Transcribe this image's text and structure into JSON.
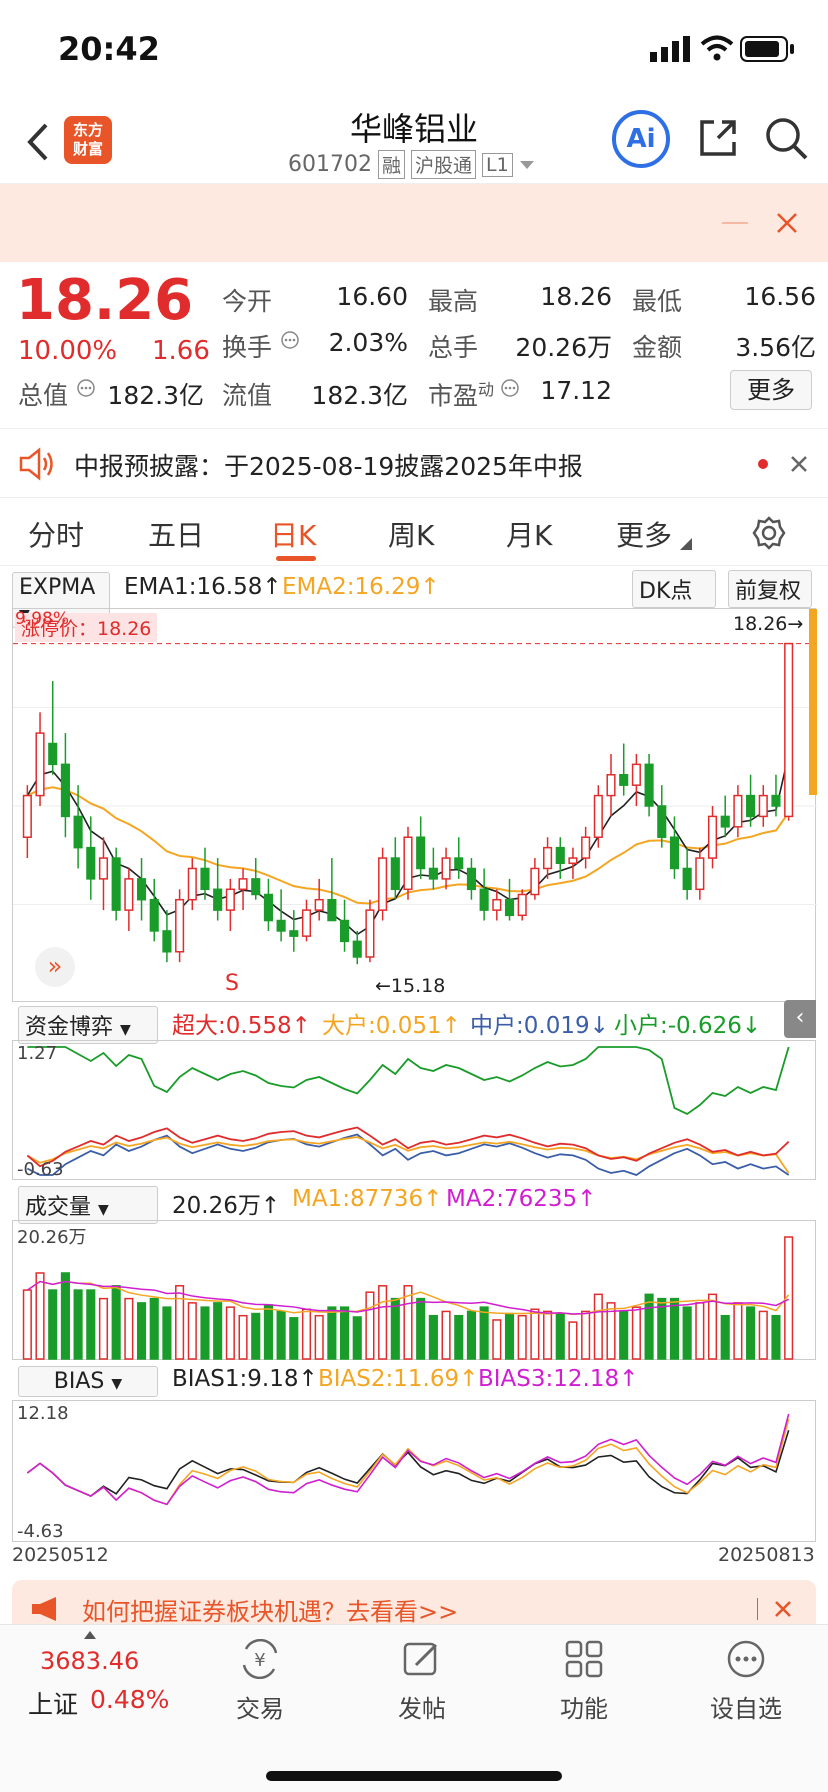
{
  "status_bar": {
    "time": "20:42"
  },
  "nav": {
    "back_icon": "back-icon",
    "logo_text_1": "东方",
    "logo_text_2": "财富",
    "title": "华峰铝业",
    "code": "601702",
    "tags": [
      "融",
      "沪股通",
      "L1"
    ],
    "ai_label": "Ai"
  },
  "quote": {
    "price": "18.26",
    "pct": "10.00%",
    "change": "1.66",
    "rows": [
      [
        {
          "l": "今开",
          "v": "16.60",
          "c": "#222"
        },
        {
          "l": "最高",
          "v": "18.26",
          "c": "#e02c2c"
        },
        {
          "l": "最低",
          "v": "16.56",
          "c": "#1a9c2a"
        }
      ],
      [
        {
          "l": "换手",
          "v": "2.03%",
          "c": "#222"
        },
        {
          "l": "总手",
          "v": "20.26万",
          "c": "#222"
        },
        {
          "l": "金额",
          "v": "3.56亿",
          "c": "#222"
        }
      ],
      [
        {
          "l": "总值",
          "v": "182.3亿",
          "c": "#222"
        },
        {
          "l": "流值",
          "v": "182.3亿",
          "c": "#222"
        },
        {
          "l": "市盈",
          "sup": "动",
          "v": "17.12",
          "c": "#222"
        }
      ]
    ],
    "more": "更多"
  },
  "notice": {
    "text": "中报预披露：于2025-08-19披露2025年中报"
  },
  "tabs": [
    "分时",
    "五日",
    "日K",
    "周K",
    "月K",
    "更多"
  ],
  "active_tab": "日K",
  "main_chart": {
    "indicator": "EXPMA",
    "ema1": "EMA1:16.58",
    "ema2": "EMA2:16.29",
    "dk": "DK点",
    "adjust": "前复权",
    "limit_label": "涨停价：18.26",
    "limit_pct": "9.98%",
    "last_price_tag": "18.26",
    "low_tag": "15.18",
    "s_label": "S"
  },
  "fund_panel": {
    "indicator": "资金博弈",
    "super": "超大:0.558",
    "large": "大户:0.051",
    "mid": "中户:0.019",
    "small": "小户:-0.626",
    "ymax": "1.27",
    "ymin": "-0.63"
  },
  "vol_panel": {
    "indicator": "成交量",
    "vol": "20.26万",
    "ma1": "MA1:87736",
    "ma2": "MA2:76235",
    "ymax": "20.26万"
  },
  "bias_panel": {
    "indicator": "BIAS",
    "b1": "BIAS1:9.18",
    "b2": "BIAS2:11.69",
    "b3": "BIAS3:12.18",
    "ymax": "12.18",
    "ymin": "-4.63"
  },
  "dates": {
    "start": "20250512",
    "end": "20250813"
  },
  "ad": {
    "text": "如何把握证券板块机遇？去看看>>"
  },
  "bottom": {
    "index_value": "3683.46",
    "index_name": "上证",
    "index_pct": "0.48%",
    "items": [
      "交易",
      "发帖",
      "功能",
      "设自选"
    ]
  },
  "chart_data": {
    "type": "candlestick",
    "candles": [
      [
        16.4,
        16.9,
        16.2,
        16.8
      ],
      [
        16.8,
        17.6,
        16.7,
        17.4
      ],
      [
        17.3,
        17.9,
        17.0,
        17.1
      ],
      [
        17.1,
        17.4,
        16.4,
        16.6
      ],
      [
        16.6,
        16.9,
        16.1,
        16.3
      ],
      [
        16.3,
        16.6,
        15.8,
        16.0
      ],
      [
        16.0,
        16.4,
        15.7,
        16.2
      ],
      [
        16.2,
        16.3,
        15.6,
        15.7
      ],
      [
        15.7,
        16.1,
        15.5,
        16.0
      ],
      [
        16.0,
        16.2,
        15.6,
        15.8
      ],
      [
        15.8,
        16.0,
        15.4,
        15.5
      ],
      [
        15.5,
        15.7,
        15.2,
        15.3
      ],
      [
        15.3,
        15.9,
        15.2,
        15.8
      ],
      [
        15.8,
        16.2,
        15.7,
        16.1
      ],
      [
        16.1,
        16.3,
        15.8,
        15.9
      ],
      [
        15.9,
        16.2,
        15.6,
        15.7
      ],
      [
        15.7,
        16.0,
        15.5,
        15.9
      ],
      [
        15.9,
        16.1,
        15.7,
        16.0
      ],
      [
        16.0,
        16.2,
        15.8,
        15.85
      ],
      [
        15.85,
        16.0,
        15.5,
        15.6
      ],
      [
        15.6,
        15.9,
        15.4,
        15.5
      ],
      [
        15.5,
        15.7,
        15.3,
        15.45
      ],
      [
        15.45,
        15.8,
        15.4,
        15.7
      ],
      [
        15.7,
        16.0,
        15.6,
        15.8
      ],
      [
        15.8,
        16.2,
        15.7,
        15.6
      ],
      [
        15.6,
        15.8,
        15.3,
        15.4
      ],
      [
        15.4,
        15.5,
        15.18,
        15.25
      ],
      [
        15.25,
        15.8,
        15.2,
        15.7
      ],
      [
        15.7,
        16.3,
        15.6,
        16.2
      ],
      [
        16.2,
        16.4,
        15.8,
        15.9
      ],
      [
        15.9,
        16.5,
        15.8,
        16.4
      ],
      [
        16.4,
        16.6,
        16.0,
        16.1
      ],
      [
        16.1,
        16.3,
        15.9,
        16.0
      ],
      [
        16.0,
        16.3,
        15.9,
        16.2
      ],
      [
        16.2,
        16.4,
        16.0,
        16.1
      ],
      [
        16.1,
        16.2,
        15.8,
        15.9
      ],
      [
        15.9,
        16.1,
        15.6,
        15.7
      ],
      [
        15.7,
        15.9,
        15.6,
        15.8
      ],
      [
        15.8,
        16.0,
        15.6,
        15.65
      ],
      [
        15.65,
        15.9,
        15.6,
        15.85
      ],
      [
        15.85,
        16.2,
        15.8,
        16.1
      ],
      [
        16.1,
        16.4,
        16.0,
        16.3
      ],
      [
        16.3,
        16.4,
        16.0,
        16.15
      ],
      [
        16.15,
        16.3,
        16.0,
        16.2
      ],
      [
        16.2,
        16.5,
        16.1,
        16.4
      ],
      [
        16.4,
        16.9,
        16.3,
        16.8
      ],
      [
        16.8,
        17.2,
        16.6,
        17.0
      ],
      [
        17.0,
        17.3,
        16.8,
        16.9
      ],
      [
        16.9,
        17.2,
        16.7,
        17.1
      ],
      [
        17.1,
        17.2,
        16.6,
        16.7
      ],
      [
        16.7,
        16.9,
        16.3,
        16.4
      ],
      [
        16.4,
        16.6,
        16.0,
        16.1
      ],
      [
        16.1,
        16.3,
        15.8,
        15.9
      ],
      [
        15.9,
        16.3,
        15.8,
        16.2
      ],
      [
        16.2,
        16.7,
        16.1,
        16.6
      ],
      [
        16.6,
        16.8,
        16.4,
        16.5
      ],
      [
        16.5,
        16.9,
        16.4,
        16.8
      ],
      [
        16.8,
        17.0,
        16.5,
        16.6
      ],
      [
        16.6,
        16.9,
        16.5,
        16.8
      ],
      [
        16.8,
        17.0,
        16.6,
        16.7
      ],
      [
        16.6,
        18.26,
        16.56,
        18.26
      ]
    ],
    "ylim": [
      15.0,
      18.4
    ],
    "legend": [
      "EMA1",
      "EMA2"
    ]
  },
  "colors": {
    "up": "#e02c2c",
    "down": "#1a9c2a",
    "accent": "#e85528",
    "ema1": "#222222",
    "ema2": "#f4a623"
  }
}
